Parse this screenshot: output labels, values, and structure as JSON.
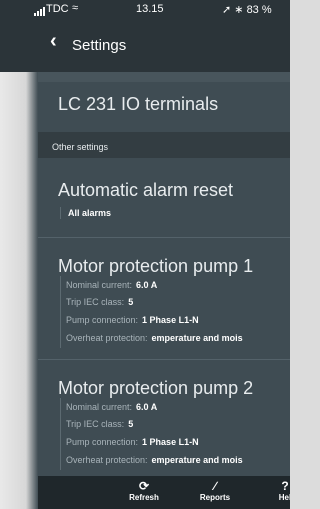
{
  "status_bar": {
    "carrier": "TDC",
    "time": "13.15",
    "battery": "83 %"
  },
  "nav": {
    "back_icon": "chevron-left-icon",
    "title": "Settings"
  },
  "terminals_row": {
    "label": "LC 231 IO terminals"
  },
  "section": {
    "label": "Other settings"
  },
  "alarm": {
    "title": "Automatic alarm reset",
    "value": "All alarms"
  },
  "pumps": [
    {
      "title": "Motor protection pump 1",
      "nominal_current_label": "Nominal current:",
      "nominal_current_value": "6.0 A",
      "trip_label": "Trip IEC class:",
      "trip_value": "5",
      "connection_label": "Pump connection:",
      "connection_value": "1 Phase L1-N",
      "overheat_label": "Overheat protection:",
      "overheat_value": "emperature and mois"
    },
    {
      "title": "Motor protection pump 2",
      "nominal_current_label": "Nominal current:",
      "nominal_current_value": "6.0 A",
      "trip_label": "Trip IEC class:",
      "trip_value": "5",
      "connection_label": "Pump connection:",
      "connection_value": "1 Phase L1-N",
      "overheat_label": "Overheat protection:",
      "overheat_value": "emperature and mois"
    }
  ],
  "tabbar": {
    "refresh": "Refresh",
    "reports": "Reports",
    "help": "Hel",
    "help_glyph": "?"
  },
  "colors": {
    "background": "#3f4c53",
    "nav": "#2b3439",
    "section": "#333d42",
    "tabbar": "#1f272b"
  }
}
